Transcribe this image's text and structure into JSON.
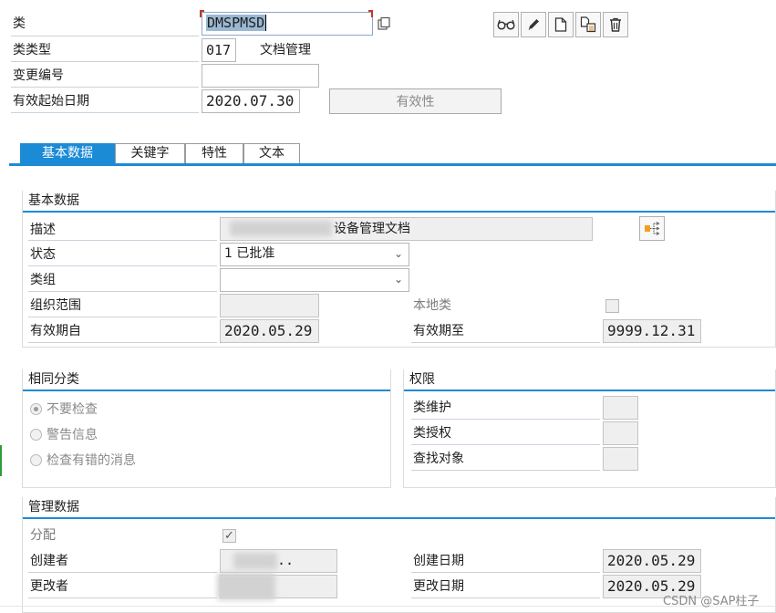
{
  "header": {
    "class_label": "类",
    "class_value": "DMSPMSD",
    "class_type_label": "类类型",
    "class_type_value": "017",
    "class_type_desc": "文档管理",
    "change_no_label": "变更编号",
    "change_no_value": "",
    "valid_from_label": "有效起始日期",
    "valid_from_value": "2020.07.30",
    "validity_button": "有效性"
  },
  "toolbar": {
    "icons": [
      "glasses-icon",
      "pencil-icon",
      "document-icon",
      "copy-icon",
      "trash-icon"
    ]
  },
  "tabs": [
    {
      "label": "基本数据",
      "active": true
    },
    {
      "label": "关键字",
      "active": false
    },
    {
      "label": "特性",
      "active": false
    },
    {
      "label": "文本",
      "active": false
    }
  ],
  "basic": {
    "title": "基本数据",
    "desc_label": "描述",
    "desc_value": "设备管理文档",
    "status_label": "状态",
    "status_value": "1 已批准",
    "class_group_label": "类组",
    "class_group_value": "",
    "org_area_label": "组织范围",
    "org_area_value": "",
    "local_class_label": "本地类",
    "valid_from_label": "有效期自",
    "valid_from_value": "2020.05.29",
    "valid_to_label": "有效期至",
    "valid_to_value": "9999.12.31"
  },
  "same_class": {
    "title": "相同分类",
    "options": [
      "不要检查",
      "警告信息",
      "检查有错的消息"
    ],
    "selected": 0
  },
  "authority": {
    "title": "权限",
    "maint_label": "类维护",
    "grant_label": "类授权",
    "search_label": "查找对象"
  },
  "admin": {
    "title": "管理数据",
    "assign_label": "分配",
    "assign_checked": true,
    "creator_label": "创建者",
    "creator_value": "..",
    "changer_label": "更改者",
    "changer_value": "",
    "created_label": "创建日期",
    "created_value": "2020.05.29",
    "changed_label": "更改日期",
    "changed_value": "2020.05.29"
  },
  "watermark": "CSDN @SAP柱子",
  "colors": {
    "accent": "#1c8bd6"
  }
}
